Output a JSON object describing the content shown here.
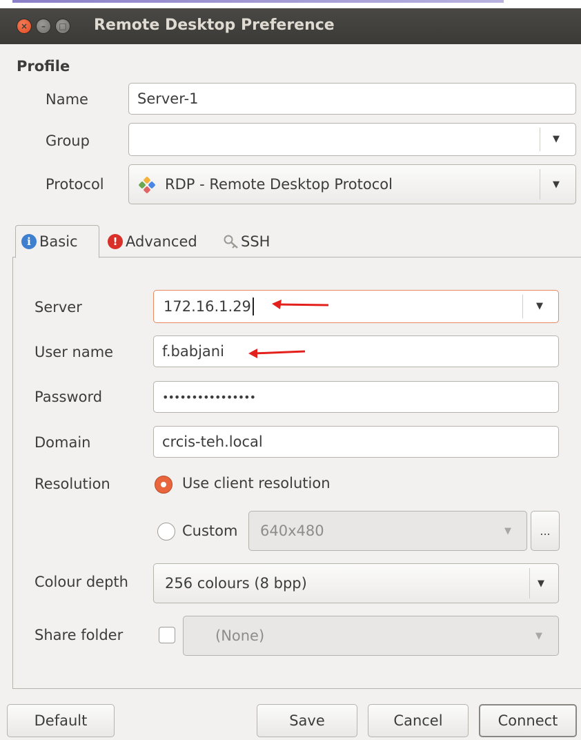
{
  "window": {
    "title": "Remote Desktop Preference",
    "close_glyph": "×",
    "min_glyph": "–",
    "max_glyph": "□"
  },
  "profile": {
    "section_label": "Profile",
    "name_label": "Name",
    "name_value": "Server-1",
    "group_label": "Group",
    "group_value": "",
    "protocol_label": "Protocol",
    "protocol_value": "RDP - Remote Desktop Protocol"
  },
  "tabs": [
    {
      "label": "Basic",
      "icon": "info-icon"
    },
    {
      "label": "Advanced",
      "icon": "warning-icon"
    },
    {
      "label": "SSH",
      "icon": "key-icon"
    }
  ],
  "basic": {
    "server_label": "Server",
    "server_value": "172.16.1.29",
    "username_label": "User name",
    "username_value": "f.babjani",
    "password_label": "Password",
    "password_value": "••••••••••••••••",
    "domain_label": "Domain",
    "domain_value": "crcis-teh.local",
    "resolution_label": "Resolution",
    "resolution_client_label": "Use client resolution",
    "resolution_custom_label": "Custom",
    "resolution_custom_value": "640x480",
    "resolution_more_label": "...",
    "colour_depth_label": "Colour depth",
    "colour_depth_value": "256 colours (8 bpp)",
    "share_folder_label": "Share folder",
    "share_folder_value": "(None)"
  },
  "buttons": {
    "default": "Default",
    "save": "Save",
    "cancel": "Cancel",
    "connect": "Connect"
  },
  "colors": {
    "annotation_arrow": "#e3201b",
    "radio_selected": "#e9653b",
    "titlebar": "#3b3a37"
  }
}
